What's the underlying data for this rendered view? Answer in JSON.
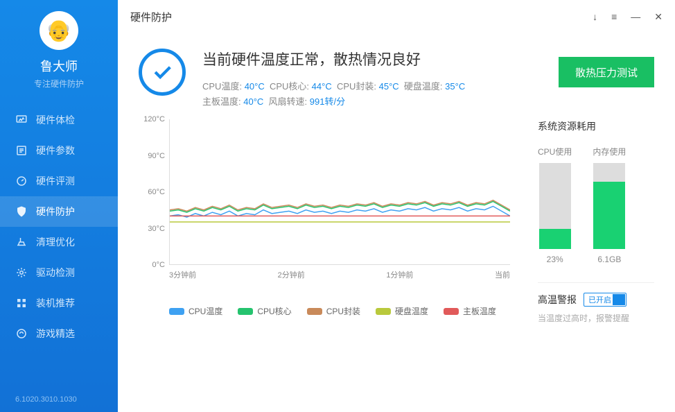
{
  "brand": {
    "title": "鲁大师",
    "subtitle": "专注硬件防护"
  },
  "sidebar": {
    "items": [
      {
        "label": "硬件体检"
      },
      {
        "label": "硬件参数"
      },
      {
        "label": "硬件评测"
      },
      {
        "label": "硬件防护"
      },
      {
        "label": "清理优化"
      },
      {
        "label": "驱动检测"
      },
      {
        "label": "装机推荐"
      },
      {
        "label": "游戏精选"
      }
    ],
    "version": "6.1020.3010.1030"
  },
  "page": {
    "title": "硬件防护"
  },
  "window": {
    "download": "↓",
    "menu": "≡",
    "min": "—",
    "close": "✕"
  },
  "hero": {
    "headline": "当前硬件温度正常，散热情况良好",
    "cpu_temp_label": "CPU温度:",
    "cpu_temp": "40°C",
    "core_label": "CPU核心:",
    "core": "44°C",
    "pkg_label": "CPU封装:",
    "pkg": "45°C",
    "disk_label": "硬盘温度:",
    "disk": "35°C",
    "mobo_label": "主板温度:",
    "mobo": "40°C",
    "fan_label": "风扇转速:",
    "fan": "991转/分",
    "stress_btn": "散热压力测试"
  },
  "chart_data": {
    "type": "line",
    "ylabel": "°C",
    "ylim": [
      0,
      120
    ],
    "yticks": [
      "120°C",
      "90°C",
      "60°C",
      "30°C",
      "0°C"
    ],
    "xticks": [
      "3分钟前",
      "2分钟前",
      "1分钟前",
      "当前"
    ],
    "series": [
      {
        "name": "CPU温度",
        "color": "#3ea1f2",
        "values": [
          40,
          41,
          39,
          42,
          40,
          43,
          41,
          44,
          40,
          42,
          41,
          45,
          42,
          43,
          44,
          42,
          45,
          43,
          44,
          42,
          44,
          43,
          45,
          44,
          46,
          43,
          45,
          44,
          46,
          45,
          47,
          44,
          46,
          45,
          47,
          44,
          46,
          45,
          48,
          44,
          40
        ]
      },
      {
        "name": "CPU核心",
        "color": "#25c36e",
        "values": [
          44,
          45,
          43,
          46,
          44,
          47,
          45,
          48,
          44,
          46,
          45,
          49,
          46,
          47,
          48,
          46,
          49,
          47,
          48,
          46,
          48,
          47,
          49,
          48,
          50,
          47,
          49,
          48,
          50,
          49,
          51,
          48,
          50,
          49,
          51,
          48,
          50,
          49,
          52,
          48,
          44
        ]
      },
      {
        "name": "CPU封装",
        "color": "#c98a5a",
        "values": [
          45,
          46,
          44,
          47,
          45,
          48,
          46,
          49,
          45,
          47,
          46,
          50,
          47,
          48,
          49,
          47,
          50,
          48,
          49,
          47,
          49,
          48,
          50,
          49,
          51,
          48,
          50,
          49,
          51,
          50,
          52,
          49,
          51,
          50,
          52,
          49,
          51,
          50,
          53,
          49,
          45
        ]
      },
      {
        "name": "硬盘温度",
        "color": "#b9c93c",
        "values": [
          35,
          35,
          35,
          35,
          35,
          35,
          35,
          35,
          35,
          35,
          35,
          35,
          35,
          35,
          35,
          35,
          35,
          35,
          35,
          35,
          35,
          35,
          35,
          35,
          35,
          35,
          35,
          35,
          35,
          35,
          35,
          35,
          35,
          35,
          35,
          35,
          35,
          35,
          35,
          35,
          35
        ]
      },
      {
        "name": "主板温度",
        "color": "#e15a5a",
        "values": [
          40,
          40,
          40,
          40,
          40,
          40,
          40,
          40,
          40,
          40,
          40,
          40,
          40,
          40,
          40,
          40,
          40,
          40,
          40,
          40,
          40,
          40,
          40,
          40,
          40,
          40,
          40,
          40,
          40,
          40,
          40,
          40,
          40,
          40,
          40,
          40,
          40,
          40,
          40,
          40,
          40
        ]
      }
    ]
  },
  "resources": {
    "title": "系统资源耗用",
    "cpu_label": "CPU使用",
    "cpu_pct": 23,
    "cpu_text": "23%",
    "mem_label": "内存使用",
    "mem_pct": 78,
    "mem_text": "6.1GB"
  },
  "alarm": {
    "title": "高温警报",
    "toggle": "已开启",
    "desc": "当温度过高时，报警提醒"
  }
}
